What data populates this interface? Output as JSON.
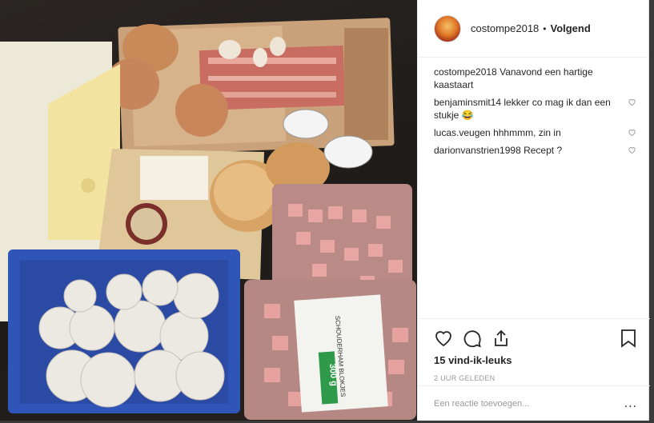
{
  "post": {
    "username": "costompe2018",
    "separator": "•",
    "follow_label": "Volgend",
    "caption_user": "costompe2018",
    "caption_text": "Vanavond een hartige kaastaart",
    "comments": [
      {
        "user": "benjaminsmit14",
        "text": "lekker co mag ik dan een stukje 😂"
      },
      {
        "user": "lucas.veugen",
        "text": "hhhmmm, zin in"
      },
      {
        "user": "darionvanstrien1998",
        "text": "Recept ?"
      }
    ],
    "likes_text": "15 vind-ik-leuks",
    "timestamp": "2 UUR GELEDEN",
    "comment_placeholder": "Een reactie toevoegen...",
    "more_label": "..."
  },
  "photo_labels": {
    "ham_pack": "SCHOUDERHAM BLOKJES",
    "ham_weight": "300 g"
  },
  "icons": [
    "heart-icon",
    "comment-icon",
    "share-icon",
    "bookmark-icon"
  ]
}
